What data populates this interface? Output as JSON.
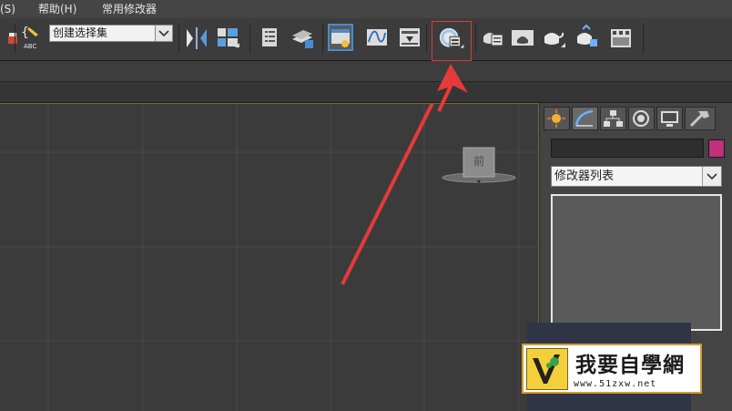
{
  "menu": {
    "items": [
      "(S)",
      "帮助(H)",
      "常用修改器"
    ]
  },
  "toolbar": {
    "named_selection_set": "创建选择集",
    "icons": [
      "teapot-render-icon",
      "edit-named-selection-icon",
      "mirror-icon",
      "align-icon",
      "scene-explorer-icon",
      "layer-manager-icon",
      "toggle-ribbon-icon",
      "curve-editor-icon",
      "schematic-view-icon",
      "material-editor-icon",
      "render-setup-icon",
      "rendered-frame-window-icon",
      "render-production-icon",
      "render-iterative-icon",
      "render-in-cloud-icon",
      "render-to-texture-icon"
    ],
    "highlight_color": "#e03a3a"
  },
  "viewport": {
    "viewcube_label": "前",
    "border_color": "#7a6a33"
  },
  "command_panel": {
    "tabs": [
      "create-tab",
      "modify-tab",
      "hierarchy-tab",
      "motion-tab",
      "display-tab",
      "utilities-tab"
    ],
    "object_name": "",
    "object_color": "#c1307a",
    "modifier_list": "修改器列表"
  },
  "watermark": {
    "title": "我要自學網",
    "url": "www.51zxw.net"
  },
  "annotation": {
    "arrow_color": "#e53a3a"
  }
}
